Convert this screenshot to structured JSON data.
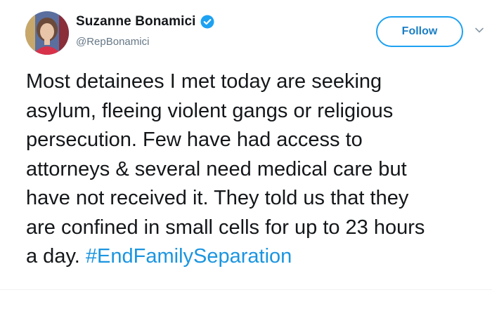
{
  "author": {
    "display_name": "Suzanne Bonamici",
    "handle": "@RepBonamici",
    "verified": true,
    "avatar_icon": "profile-photo-avatar"
  },
  "actions": {
    "follow_label": "Follow",
    "more_icon": "chevron-down-icon"
  },
  "tweet": {
    "text": "Most detainees I met today are seeking\nasylum, fleeing violent gangs or religious\npersecution. Few have had access to\nattorneys & several need medical care but\nhave not received it. They told us that they\nare confined in small cells for up to 23 hours\na day. ",
    "hashtag": "#EndFamilySeparation"
  },
  "colors": {
    "link_blue": "#1b95e0",
    "follow_border": "#1da1f2",
    "verified_blue": "#1da1f2",
    "text": "#14171a",
    "muted": "#657786"
  }
}
